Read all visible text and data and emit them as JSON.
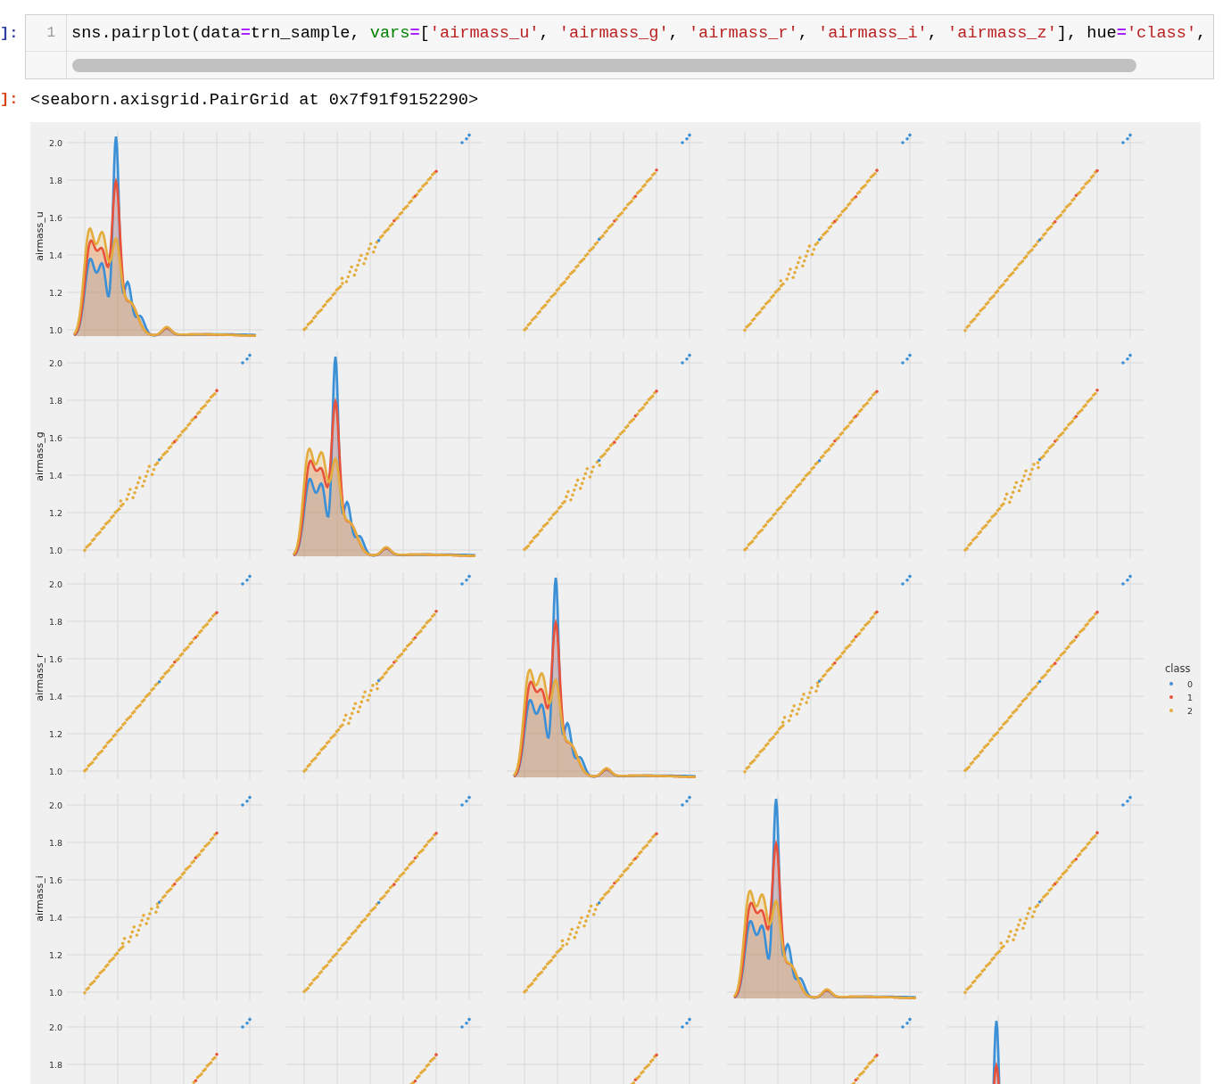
{
  "input_cell": {
    "prompt": "]:",
    "line_number": "1",
    "code": [
      {
        "text": "sns.pairplot(data",
        "kind": "plain"
      },
      {
        "text": "=",
        "kind": "operator"
      },
      {
        "text": "trn_sample, ",
        "kind": "plain"
      },
      {
        "text": "vars",
        "kind": "keyword"
      },
      {
        "text": "=",
        "kind": "operator"
      },
      {
        "text": "[",
        "kind": "plain"
      },
      {
        "text": "'airmass_u'",
        "kind": "string"
      },
      {
        "text": ", ",
        "kind": "plain"
      },
      {
        "text": "'airmass_g'",
        "kind": "string"
      },
      {
        "text": ", ",
        "kind": "plain"
      },
      {
        "text": "'airmass_r'",
        "kind": "string"
      },
      {
        "text": ", ",
        "kind": "plain"
      },
      {
        "text": "'airmass_i'",
        "kind": "string"
      },
      {
        "text": ", ",
        "kind": "plain"
      },
      {
        "text": "'airmass_z'",
        "kind": "string"
      },
      {
        "text": "], hue",
        "kind": "plain"
      },
      {
        "text": "=",
        "kind": "operator"
      },
      {
        "text": "'class'",
        "kind": "string"
      },
      {
        "text": ",",
        "kind": "plain"
      }
    ]
  },
  "output_cell": {
    "prompt": "]:",
    "text": "<seaborn.axisgrid.PairGrid at 0x7f91f9152290>"
  },
  "figure": {
    "rows": [
      {
        "label": "airmass_u",
        "yticks": [
          "2.0",
          "1.8",
          "1.6",
          "1.4",
          "1.2",
          "1.0"
        ],
        "panels": [
          {
            "kind": "kde"
          },
          {
            "kind": "scatter"
          },
          {
            "kind": "scatter"
          },
          {
            "kind": "scatter"
          },
          {
            "kind": "scatter"
          }
        ]
      },
      {
        "label": "airmass_g",
        "yticks": [
          "2.0",
          "1.8",
          "1.6",
          "1.4",
          "1.2",
          "1.0"
        ],
        "panels": [
          {
            "kind": "scatter"
          },
          {
            "kind": "kde"
          },
          {
            "kind": "scatter"
          },
          {
            "kind": "scatter"
          },
          {
            "kind": "scatter"
          }
        ]
      },
      {
        "label": "airmass_r",
        "yticks": [
          "2.0",
          "1.8",
          "1.6",
          "1.4",
          "1.2",
          "1.0"
        ],
        "panels": [
          {
            "kind": "scatter"
          },
          {
            "kind": "scatter"
          },
          {
            "kind": "kde"
          },
          {
            "kind": "scatter"
          },
          {
            "kind": "scatter"
          }
        ]
      },
      {
        "label": "airmass_i",
        "yticks": [
          "2.0",
          "1.8",
          "1.6",
          "1.4",
          "1.2",
          "1.0"
        ],
        "panels": [
          {
            "kind": "scatter"
          },
          {
            "kind": "scatter"
          },
          {
            "kind": "scatter"
          },
          {
            "kind": "kde"
          },
          {
            "kind": "scatter"
          }
        ]
      },
      {
        "yticks": [
          "2.0",
          "1.8"
        ],
        "panels": [
          {
            "kind": "scatter"
          },
          {
            "kind": "scatter"
          },
          {
            "kind": "scatter"
          },
          {
            "kind": "scatter"
          },
          {
            "kind": "kde"
          }
        ]
      }
    ],
    "legend": {
      "title": "class",
      "entries": [
        {
          "label": "0",
          "color": "#3a8fd6"
        },
        {
          "label": "1",
          "color": "#e9523a"
        },
        {
          "label": "2",
          "color": "#e4ac3d"
        }
      ]
    }
  }
}
